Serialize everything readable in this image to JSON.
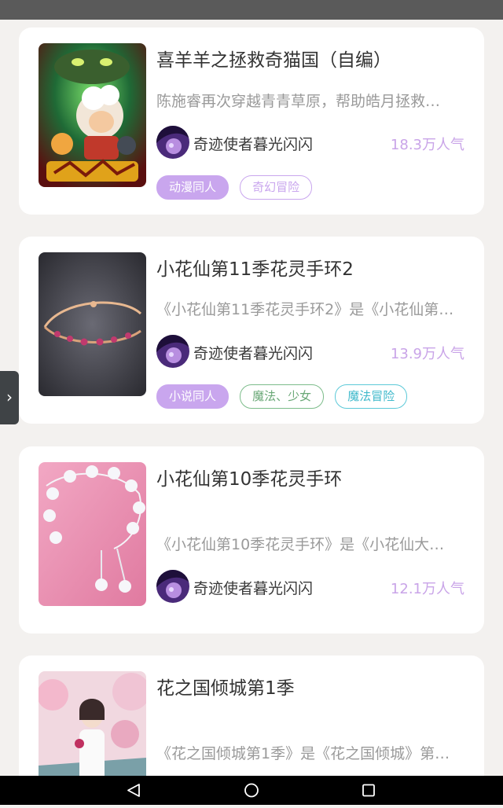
{
  "cards": [
    {
      "title": "喜羊羊之拯救奇猫国（自编）",
      "description": "陈施睿再次穿越青青草原，帮助皓月拯救…",
      "author": "奇迹使者暮光闪闪",
      "popularity": "18.3万人气",
      "tags": [
        "动漫同人",
        "奇幻冒险"
      ]
    },
    {
      "title": "小花仙第11季花灵手环2",
      "description": "《小花仙第11季花灵手环2》是《小花仙第…",
      "author": "奇迹使者暮光闪闪",
      "popularity": "13.9万人气",
      "tags": [
        "小说同人",
        "魔法、少女",
        "魔法冒险"
      ]
    },
    {
      "title": "小花仙第10季花灵手环",
      "description": "《小花仙第10季花灵手环》是《小花仙大…",
      "author": "奇迹使者暮光闪闪",
      "popularity": "12.1万人气",
      "tags": []
    },
    {
      "title": "花之国倾城第1季",
      "description": "《花之国倾城第1季》是《花之国倾城》第…",
      "author": "",
      "popularity": "",
      "tags": []
    }
  ],
  "side_handle": {
    "icon": "chevron-right-icon"
  },
  "nav": {
    "back_icon": "back-triangle-icon",
    "home_icon": "home-circle-icon",
    "recents_icon": "recents-square-icon"
  },
  "colors": {
    "accent_purple": "#c9a6ee",
    "tag_green": "#7cbc8a",
    "tag_cyan": "#5cc9d8"
  }
}
